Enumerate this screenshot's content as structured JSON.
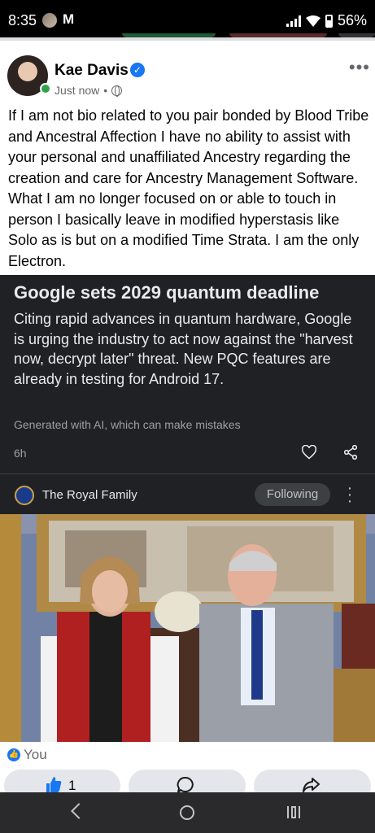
{
  "status_bar": {
    "time": "8:35",
    "battery": "56%",
    "icons": [
      "contact-avatar-icon",
      "gmail-icon",
      "signal-icon",
      "wifi-icon",
      "battery-icon"
    ]
  },
  "fb_post": {
    "author": "Kae Davis",
    "timestamp": "Just now",
    "separator": "•",
    "text": "If I am not bio related to you pair bonded by Blood Tribe and Ancestral Affection I have no ability to assist with your personal and unaffiliated Ancestry regarding the creation and care for Ancestry Management Software. What I am no longer focused on or able to touch in person I basically leave in modified hyperstasis like Solo as is but on a modified Time Strata. I am the only Electron."
  },
  "news_card": {
    "title": "Google sets 2029 quantum deadline",
    "summary": "Citing rapid advances in quantum hardware, Google is urging the industry to act now against the \"harvest now, decrypt later\" threat. New PQC features are already in testing for Android 17.",
    "disclaimer": "Generated with AI, which can make mistakes",
    "age": "6h"
  },
  "source": {
    "name": "The Royal Family",
    "follow_label": "Following"
  },
  "reactions": {
    "label": "You",
    "like_count": "1"
  },
  "colors": {
    "facebook_blue": "#1877f2",
    "online_green": "#31a24c",
    "dark_card": "#202124"
  }
}
